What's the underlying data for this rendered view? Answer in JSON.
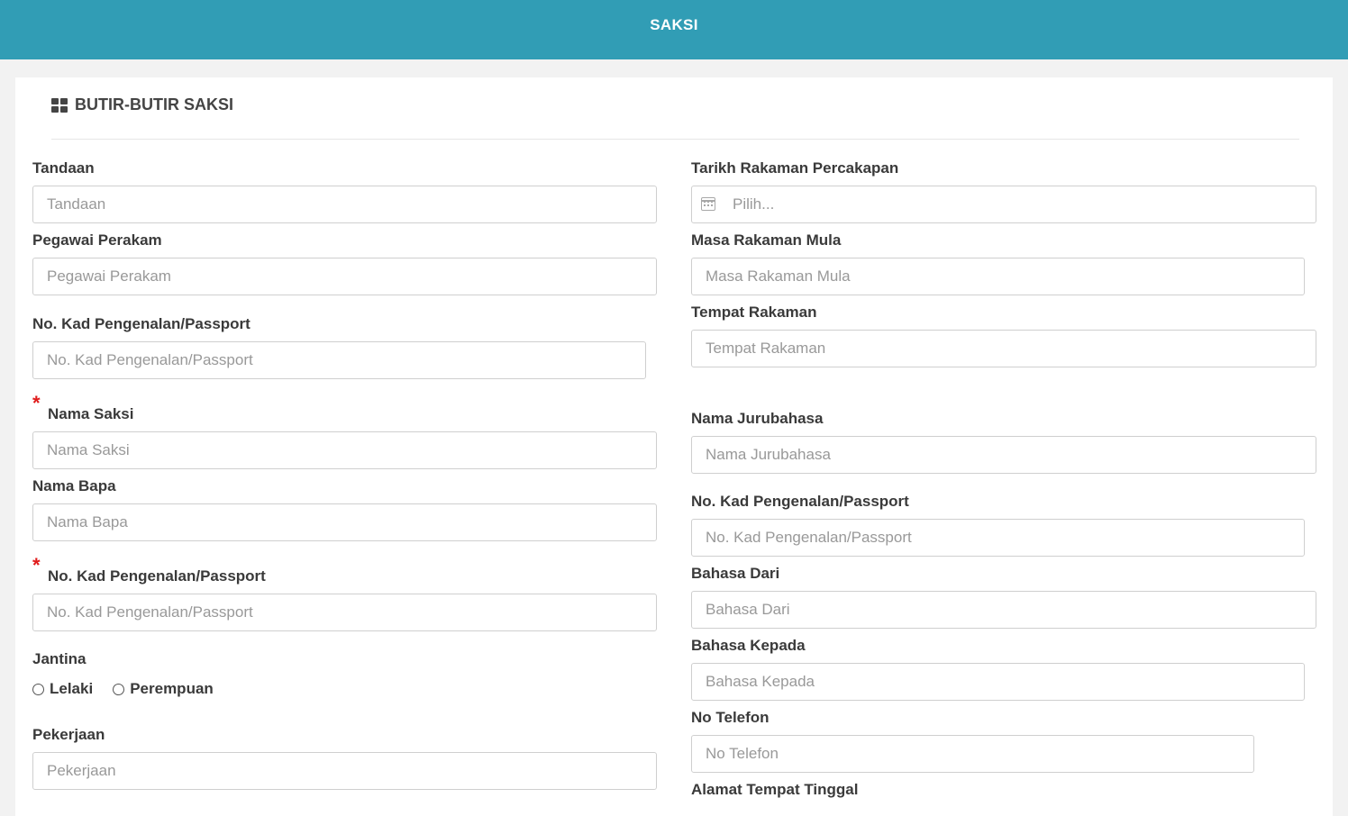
{
  "header": {
    "title": "SAKSI"
  },
  "section": {
    "icon": "grid-icon",
    "title": "BUTIR-BUTIR SAKSI"
  },
  "left": {
    "tandaan": {
      "label": "Tandaan",
      "placeholder": "Tandaan"
    },
    "pegawai_perakam": {
      "label": "Pegawai Perakam",
      "placeholder": "Pegawai Perakam"
    },
    "no_kad_1": {
      "label": "No. Kad Pengenalan/Passport",
      "placeholder": "No. Kad Pengenalan/Passport"
    },
    "nama_saksi": {
      "label": "Nama Saksi",
      "placeholder": "Nama Saksi",
      "required_mark": "*"
    },
    "nama_bapa": {
      "label": "Nama Bapa",
      "placeholder": "Nama Bapa"
    },
    "no_kad_2": {
      "label": "No. Kad Pengenalan/Passport",
      "placeholder": "No. Kad Pengenalan/Passport",
      "required_mark": "*"
    },
    "jantina": {
      "label": "Jantina",
      "options": [
        "Lelaki",
        "Perempuan"
      ]
    },
    "pekerjaan": {
      "label": "Pekerjaan",
      "placeholder": "Pekerjaan"
    }
  },
  "right": {
    "tarikh": {
      "label": "Tarikh Rakaman Percakapan",
      "placeholder": "Pilih...",
      "icon": "calendar-icon"
    },
    "masa_mula": {
      "label": "Masa Rakaman Mula",
      "placeholder": "Masa Rakaman Mula"
    },
    "tempat": {
      "label": "Tempat Rakaman",
      "placeholder": "Tempat Rakaman"
    },
    "jurubahasa": {
      "label": "Nama Jurubahasa",
      "placeholder": "Nama Jurubahasa"
    },
    "no_kad": {
      "label": "No. Kad Pengenalan/Passport",
      "placeholder": "No. Kad Pengenalan/Passport"
    },
    "bahasa_dari": {
      "label": "Bahasa Dari",
      "placeholder": "Bahasa Dari"
    },
    "bahasa_kepada": {
      "label": "Bahasa Kepada",
      "placeholder": "Bahasa Kepada"
    },
    "telefon": {
      "label": "No Telefon",
      "placeholder": "No Telefon"
    },
    "alamat": {
      "label": "Alamat Tempat Tinggal"
    }
  }
}
